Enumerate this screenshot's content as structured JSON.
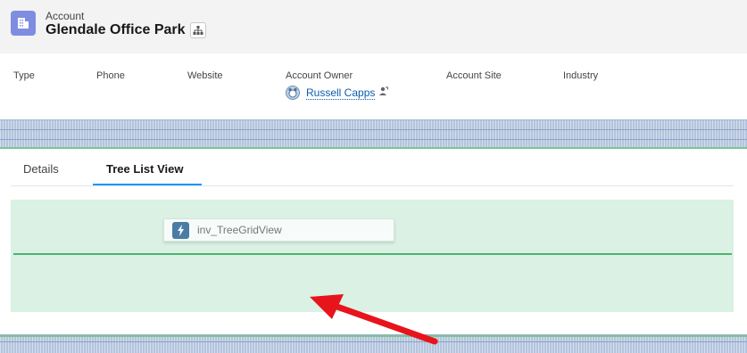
{
  "header": {
    "object_label": "Account",
    "record_name": "Glendale Office Park",
    "record_icon": "building-icon",
    "hierarchy_icon": "hierarchy-icon"
  },
  "fields": {
    "type_label": "Type",
    "phone_label": "Phone",
    "website_label": "Website",
    "owner_label": "Account Owner",
    "owner_name": "Russell Capps",
    "site_label": "Account Site",
    "industry_label": "Industry"
  },
  "tabs": [
    {
      "label": "Details",
      "active": false
    },
    {
      "label": "Tree List View",
      "active": true
    }
  ],
  "component": {
    "label": "inv_TreeGridView",
    "icon": "lightning-icon"
  },
  "colors": {
    "accent": "#1b96ff",
    "drop_zone": "#daf1e3",
    "drop_line": "#4bb56e",
    "annotation_arrow": "#e8141b"
  }
}
